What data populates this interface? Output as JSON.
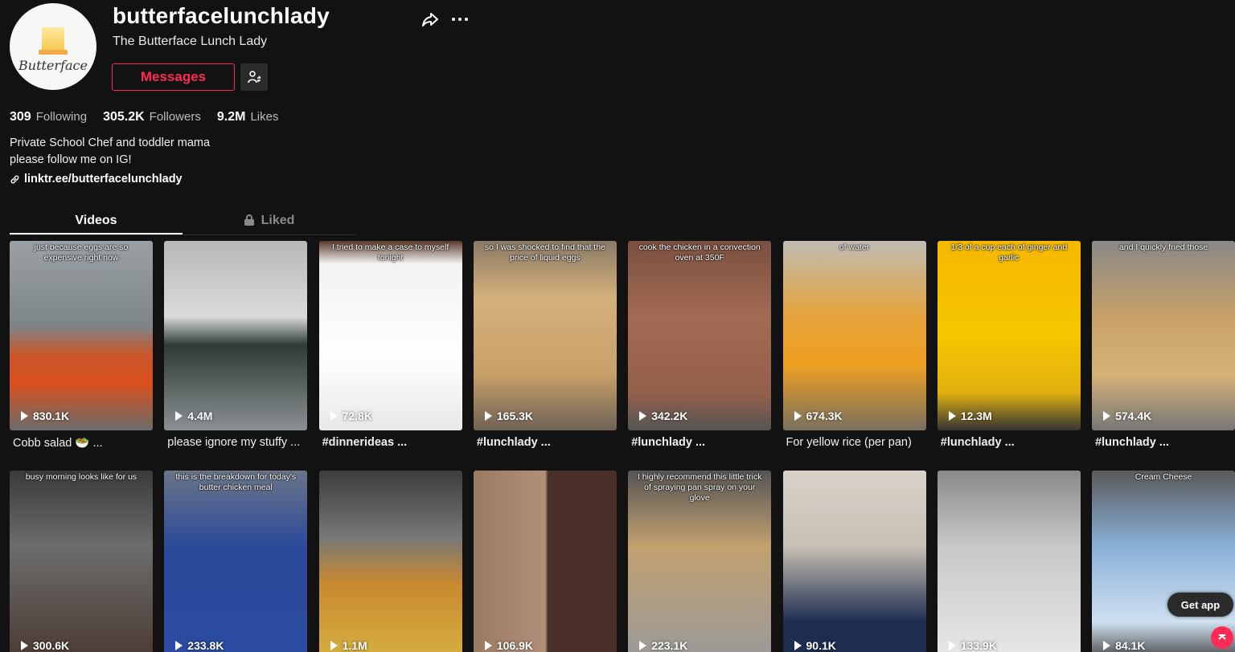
{
  "profile": {
    "username": "butterfacelunchlady",
    "nickname": "The Butterface Lunch Lady",
    "avatar_text": "Butterface",
    "messages_label": "Messages",
    "following_count": "309",
    "following_label": "Following",
    "followers_count": "305.2K",
    "followers_label": "Followers",
    "likes_count": "9.2M",
    "likes_label": "Likes",
    "bio_line1": "Private School Chef and toddler mama",
    "bio_line2": "please follow me on IG!",
    "link": "linktr.ee/butterfacelunchlady"
  },
  "tabs": {
    "videos": "Videos",
    "liked": "Liked"
  },
  "videos_row1": [
    {
      "plays": "830.1K",
      "caption": "Cobb salad 🥗 ...",
      "overlay": "just because eggs are so expensive right now"
    },
    {
      "plays": "4.4M",
      "caption": "please ignore my stuffy ...",
      "overlay": ""
    },
    {
      "plays": "72.8K",
      "caption": "#dinnerideas ...",
      "overlay": "I tried to make a case to myself tonight"
    },
    {
      "plays": "165.3K",
      "caption": "#lunchlady ...",
      "overlay": "so I was shocked to find that the price of liquid eggs"
    },
    {
      "plays": "342.2K",
      "caption": "#lunchlady ...",
      "overlay": "cook the chicken in a convection oven at 350F"
    },
    {
      "plays": "674.3K",
      "caption": "For yellow rice (per pan)",
      "overlay": "of water"
    },
    {
      "plays": "12.3M",
      "caption": "#lunchlady ...",
      "overlay": "1/3 of a cup each of ginger and garlic"
    },
    {
      "plays": "574.4K",
      "caption": "#lunchlady ...",
      "overlay": "and I quickly fried those"
    }
  ],
  "videos_row2": [
    {
      "plays": "300.6K",
      "overlay": "busy morning looks like for us"
    },
    {
      "plays": "233.8K",
      "overlay": "this is the breakdown for today's butter chicken meal"
    },
    {
      "plays": "1.1M",
      "overlay": ""
    },
    {
      "plays": "106.9K",
      "overlay": ""
    },
    {
      "plays": "223.1K",
      "overlay": "I highly recommend this little trick of spraying pan spray on your glove"
    },
    {
      "plays": "90.1K",
      "overlay": ""
    },
    {
      "plays": "133.9K",
      "overlay": ""
    },
    {
      "plays": "84.1K",
      "overlay": "Cream Cheese"
    }
  ],
  "get_app_label": "Get app",
  "colors": {
    "accent": "#fe2c55",
    "background": "#121212"
  }
}
